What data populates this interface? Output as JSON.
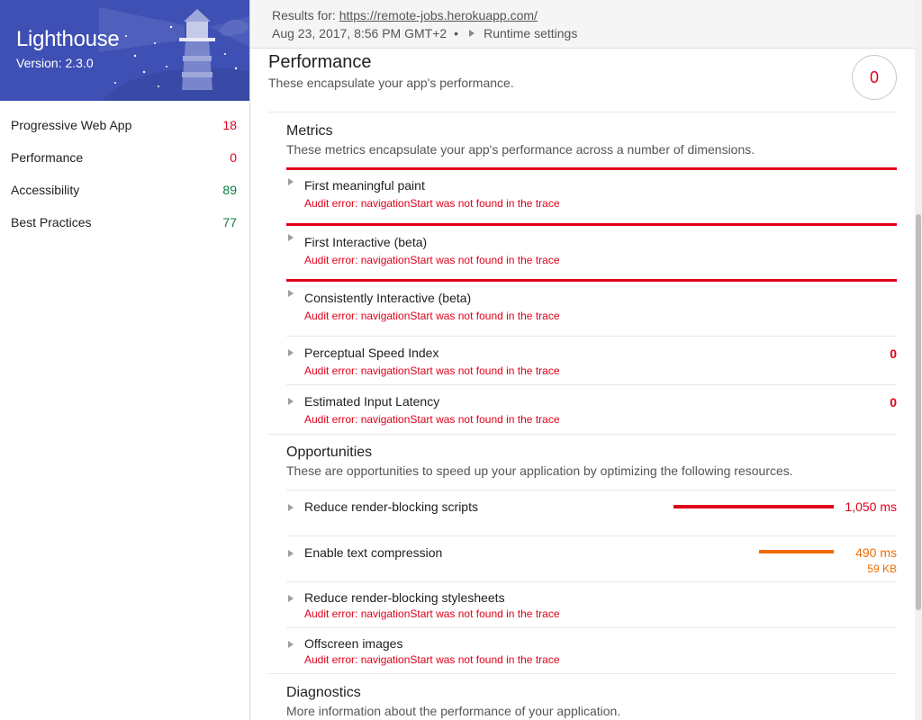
{
  "app": {
    "title": "Lighthouse",
    "version": "Version: 2.3.0"
  },
  "sidebar": {
    "categories": [
      {
        "name": "Progressive Web App",
        "score": "18",
        "color": "#e0001a"
      },
      {
        "name": "Performance",
        "score": "0",
        "color": "#e0001a"
      },
      {
        "name": "Accessibility",
        "score": "89",
        "color": "#0b8043"
      },
      {
        "name": "Best Practices",
        "score": "77",
        "color": "#0b8043"
      }
    ]
  },
  "header": {
    "results_label": "Results for: ",
    "url": "https://remote-jobs.herokuapp.com/",
    "timestamp": "Aug 23, 2017, 8:56 PM GMT+2",
    "separator": "•",
    "runtime_settings": "Runtime settings"
  },
  "performance": {
    "title": "Performance",
    "description": "These encapsulate your app's performance.",
    "score": "0"
  },
  "metrics": {
    "title": "Metrics",
    "description": "These metrics encapsulate your app's performance across a number of dimensions.",
    "items": [
      {
        "title": "First meaningful paint",
        "error": "Audit error: navigationStart was not found in the trace",
        "score": ""
      },
      {
        "title": "First Interactive (beta)",
        "error": "Audit error: navigationStart was not found in the trace",
        "score": ""
      },
      {
        "title": "Consistently Interactive (beta)",
        "error": "Audit error: navigationStart was not found in the trace",
        "score": ""
      },
      {
        "title": "Perceptual Speed Index",
        "error": "Audit error: navigationStart was not found in the trace",
        "score": "0"
      },
      {
        "title": "Estimated Input Latency",
        "error": "Audit error: navigationStart was not found in the trace",
        "score": "0"
      }
    ]
  },
  "opportunities": {
    "title": "Opportunities",
    "description": "These are opportunities to speed up your application by optimizing the following resources.",
    "items": [
      {
        "title": "Reduce render-blocking scripts",
        "value": "1,050 ms",
        "bar_fraction": 1.0,
        "color": "#e0001a"
      },
      {
        "title": "Enable text compression",
        "value": "490 ms",
        "subvalue": "59 KB",
        "bar_fraction": 0.47,
        "color": "#ef6c00"
      },
      {
        "title": "Reduce render-blocking stylesheets",
        "error": "Audit error: navigationStart was not found in the trace"
      },
      {
        "title": "Offscreen images",
        "error": "Audit error: navigationStart was not found in the trace"
      }
    ]
  },
  "diagnostics": {
    "title": "Diagnostics",
    "description": "More information about the performance of your application."
  },
  "icons": {
    "expand": "triangle-right-icon",
    "runtime": "triangle-right-icon",
    "banner": "lighthouse-illustration"
  }
}
